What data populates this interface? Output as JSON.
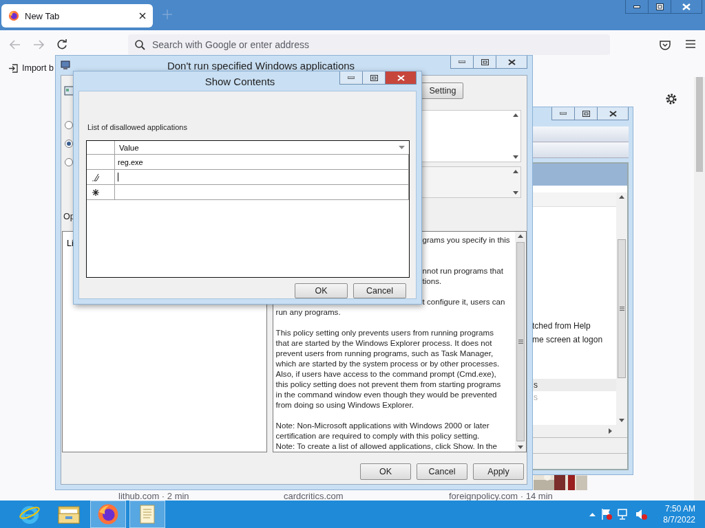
{
  "browser": {
    "tab": {
      "title": "New Tab",
      "selected": true
    },
    "address_placeholder": "Search with Google or enter address",
    "bookmark": "Import b",
    "stories": [
      "lithub.com · 2 min",
      "cardcritics.com",
      "foreignpolicy.com · 14 min"
    ]
  },
  "policy_dialog": {
    "title": "Don't run specified Windows applications",
    "setting_button": "Setting",
    "options": [
      {
        "selected": false
      },
      {
        "selected": true
      },
      {
        "selected": false
      }
    ],
    "options_label": "Op",
    "options_box_text": "Li",
    "help_lines": [
      {
        "kind": "partial",
        "text": "grams you specify in this"
      },
      {
        "kind": "blank"
      },
      {
        "kind": "blank"
      },
      {
        "kind": "partial",
        "text": "nnot run programs that"
      },
      {
        "kind": "partial",
        "text": "tions."
      },
      {
        "kind": "blank"
      },
      {
        "kind": "partial",
        "text": "t configure it, users can"
      },
      {
        "kind": "full",
        "text": "run any programs."
      },
      {
        "kind": "blank"
      },
      {
        "kind": "full",
        "text": "This policy setting only prevents users from running programs"
      },
      {
        "kind": "full",
        "text": "that are started by the Windows Explorer process. It does not"
      },
      {
        "kind": "full",
        "text": "prevent users from running programs, such as Task Manager,"
      },
      {
        "kind": "full",
        "text": "which are started by the system process or by other processes."
      },
      {
        "kind": "full",
        "text": "Also, if users have access to the command prompt (Cmd.exe),"
      },
      {
        "kind": "full",
        "text": "this policy setting does not prevent them from starting programs"
      },
      {
        "kind": "full",
        "text": "in the command window even though they would be prevented"
      },
      {
        "kind": "full",
        "text": "from doing so using Windows Explorer."
      },
      {
        "kind": "blank"
      },
      {
        "kind": "full",
        "text": "Note: Non-Microsoft applications with Windows 2000 or later"
      },
      {
        "kind": "full",
        "text": "certification are required to comply with this policy setting."
      },
      {
        "kind": "full",
        "text": "Note: To create a list of allowed applications, click Show.  In the"
      }
    ],
    "buttons": [
      "OK",
      "Cancel",
      "Apply"
    ]
  },
  "show_contents": {
    "title": "Show Contents",
    "label": "List of disallowed applications",
    "column": "Value",
    "rows": [
      {
        "kind": "value",
        "value": "reg.exe"
      },
      {
        "kind": "editing"
      },
      {
        "kind": "new"
      }
    ],
    "buttons": [
      "OK",
      "Cancel"
    ]
  },
  "background_window": {
    "lines": [
      "tched from Help",
      "me screen at logon"
    ],
    "items": [
      {
        "text": "s",
        "selected": true
      },
      {
        "text": "s",
        "selected": false
      }
    ]
  },
  "taskbar": {
    "apps": [
      {
        "kind": "ie",
        "selected": false
      },
      {
        "kind": "explorer",
        "selected": false
      },
      {
        "kind": "firefox",
        "selected": true
      },
      {
        "kind": "notepad",
        "selected": true
      }
    ],
    "time": "7:50 AM",
    "date": "8/7/2022"
  }
}
